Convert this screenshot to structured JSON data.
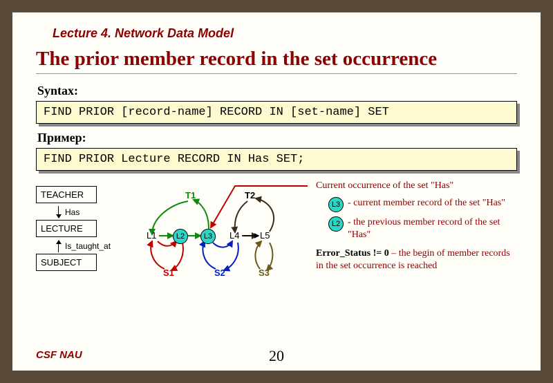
{
  "lecture_tag": "Lecture 4. Network Data Model",
  "title": "The prior member record in the set occurrence",
  "syntax": {
    "label": "Syntax:",
    "code": "FIND PRIOR [record-name] RECORD IN [set-name] SET"
  },
  "example": {
    "label": "Пример:",
    "code": "FIND PRIOR Lecture RECORD IN Has SET;"
  },
  "schema": {
    "teacher": "TEACHER",
    "has": "Has",
    "lecture": "LECTURE",
    "is_taught_at": "Is_taught_at",
    "subject": "SUBJECT"
  },
  "diagram": {
    "owners": {
      "T1": "T1",
      "T2": "T2"
    },
    "members": {
      "L1": "L1",
      "L2": "L2",
      "L3": "L3",
      "L4": "L4",
      "L5": "L5"
    },
    "subjects": {
      "S1": "S1",
      "S2": "S2",
      "S3": "S3"
    },
    "colors": {
      "T1": "#0b8a0b",
      "T2": "#3a2a1a",
      "S1": "#c00000",
      "S2": "#0020c0",
      "S3": "#6a5a1a",
      "pointer": "#c00000"
    }
  },
  "legend": {
    "heading": "Current occurrence of the set \"Has\"",
    "l3_node": "L3",
    "l3_text": "- current member record of the set \"Has\"",
    "l2_node": "L2",
    "l2_text": "- the previous member record of the set \"Has\"",
    "error_label": "Error_Status != 0",
    "error_dash": " – ",
    "error_text": "the begin of member records in the set occurrence is reached"
  },
  "footer": "CSF NAU",
  "page": "20"
}
